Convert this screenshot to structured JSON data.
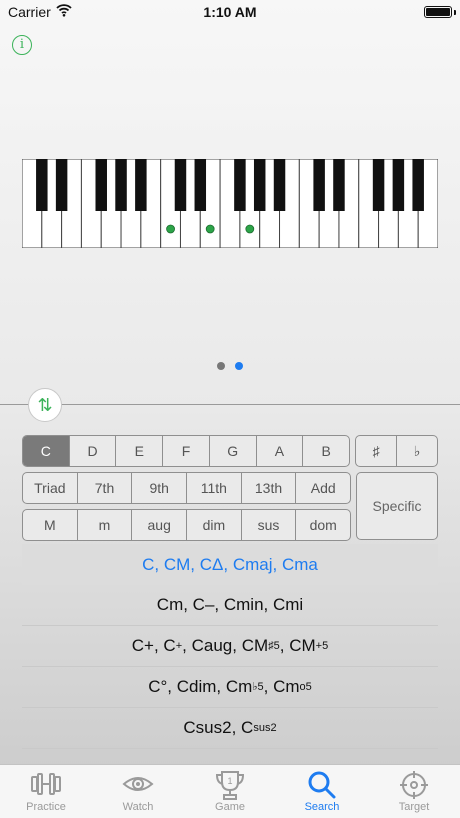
{
  "status_bar": {
    "carrier": "Carrier",
    "time": "1:10 AM"
  },
  "keyboard": {
    "white_key_count": 21,
    "black_key_pattern": [
      1,
      1,
      0,
      1,
      1,
      1,
      0
    ],
    "marked_white_keys": [
      7,
      9,
      11
    ],
    "marker_color": "#2ca448"
  },
  "pager": {
    "pages": 2,
    "current": 2
  },
  "notes": {
    "items": [
      "C",
      "D",
      "E",
      "F",
      "G",
      "A",
      "B"
    ],
    "selected": "C"
  },
  "accidentals": {
    "items": [
      "♯",
      "♭"
    ]
  },
  "extensions": {
    "items": [
      "Triad",
      "7th",
      "9th",
      "11th",
      "13th",
      "Add"
    ]
  },
  "qualities": {
    "items": [
      "M",
      "m",
      "aug",
      "dim",
      "sus",
      "dom"
    ]
  },
  "specific_label": "Specific",
  "chords": [
    {
      "parts": [
        {
          "t": "C, CM, CΔ, Cmaj, Cma"
        }
      ],
      "selected": true
    },
    {
      "parts": [
        {
          "t": "Cm, C–, Cmin, Cmi"
        }
      ]
    },
    {
      "parts": [
        {
          "t": "C+, C"
        },
        {
          "sup": "+"
        },
        {
          "t": ", Caug, CM"
        },
        {
          "sup": "♯5"
        },
        {
          "t": ", CM"
        },
        {
          "sup": "+5"
        }
      ]
    },
    {
      "parts": [
        {
          "t": "C°, Cdim, Cm"
        },
        {
          "sup": "♭5"
        },
        {
          "t": ", Cm"
        },
        {
          "sup": "o5"
        }
      ]
    },
    {
      "parts": [
        {
          "t": "Csus2, C"
        },
        {
          "sup": "sus2"
        }
      ]
    }
  ],
  "tabs": [
    {
      "label": "Practice",
      "icon": "dumbbell-icon",
      "active": false
    },
    {
      "label": "Watch",
      "icon": "eye-icon",
      "active": false
    },
    {
      "label": "Game",
      "icon": "trophy-icon",
      "active": false
    },
    {
      "label": "Search",
      "icon": "search-icon",
      "active": true
    },
    {
      "label": "Target",
      "icon": "crosshair-icon",
      "active": false
    }
  ],
  "colors": {
    "accent": "#1e7cf0",
    "green": "#3cb35a"
  }
}
